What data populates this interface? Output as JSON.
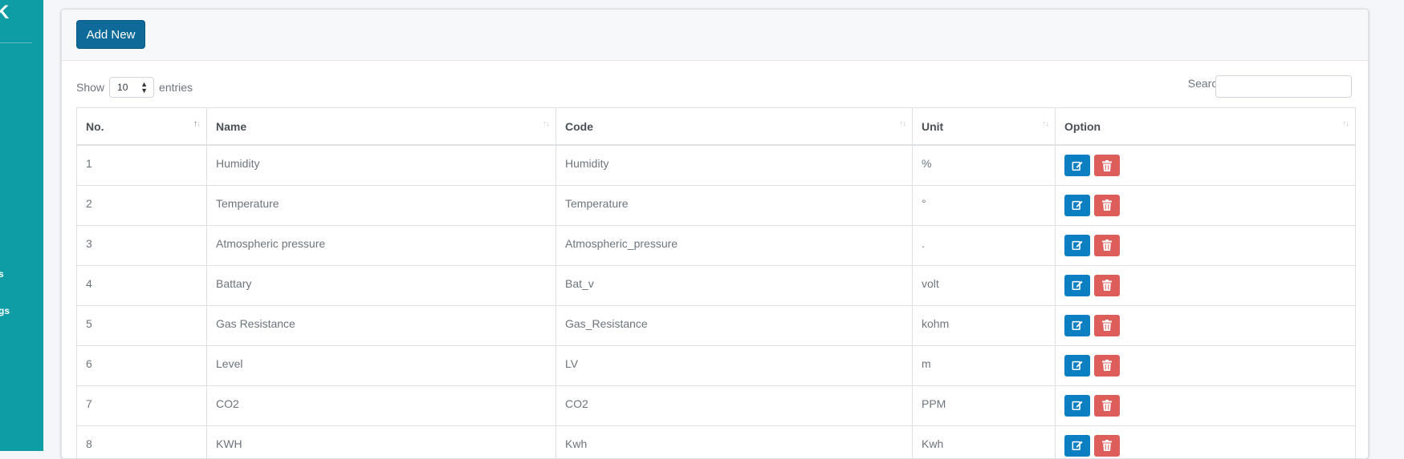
{
  "sidebar": {
    "brand_fragment": "K",
    "nav_fragments": [
      "s",
      "gs"
    ]
  },
  "header": {
    "add_button_label": "Add New"
  },
  "length_menu": {
    "show_label": "Show",
    "selected": "10",
    "entries_label": "entries"
  },
  "search": {
    "label": "Search:",
    "value": ""
  },
  "table": {
    "columns": [
      "No.",
      "Name",
      "Code",
      "Unit",
      "Option"
    ],
    "rows": [
      {
        "no": "1",
        "name": "Humidity",
        "code": "Humidity",
        "unit": "%"
      },
      {
        "no": "2",
        "name": "Temperature",
        "code": "Temperature",
        "unit": "°"
      },
      {
        "no": "3",
        "name": "Atmospheric pressure",
        "code": "Atmospheric_pressure",
        "unit": "."
      },
      {
        "no": "4",
        "name": "Battary",
        "code": "Bat_v",
        "unit": "volt"
      },
      {
        "no": "5",
        "name": "Gas Resistance",
        "code": "Gas_Resistance",
        "unit": "kohm"
      },
      {
        "no": "6",
        "name": "Level",
        "code": "LV",
        "unit": "m"
      },
      {
        "no": "7",
        "name": "CO2",
        "code": "CO2",
        "unit": "PPM"
      },
      {
        "no": "8",
        "name": "KWH",
        "code": "Kwh",
        "unit": "Kwh"
      }
    ]
  },
  "colors": {
    "sidebar_bg": "#0e9ca5",
    "primary_button": "#0e6a99",
    "edit_button": "#0c7ec2",
    "delete_button": "#dc5d5a"
  },
  "icons": {
    "edit": "pencil-square-icon",
    "delete": "trash-icon",
    "sort": "sort-arrows-icon"
  }
}
